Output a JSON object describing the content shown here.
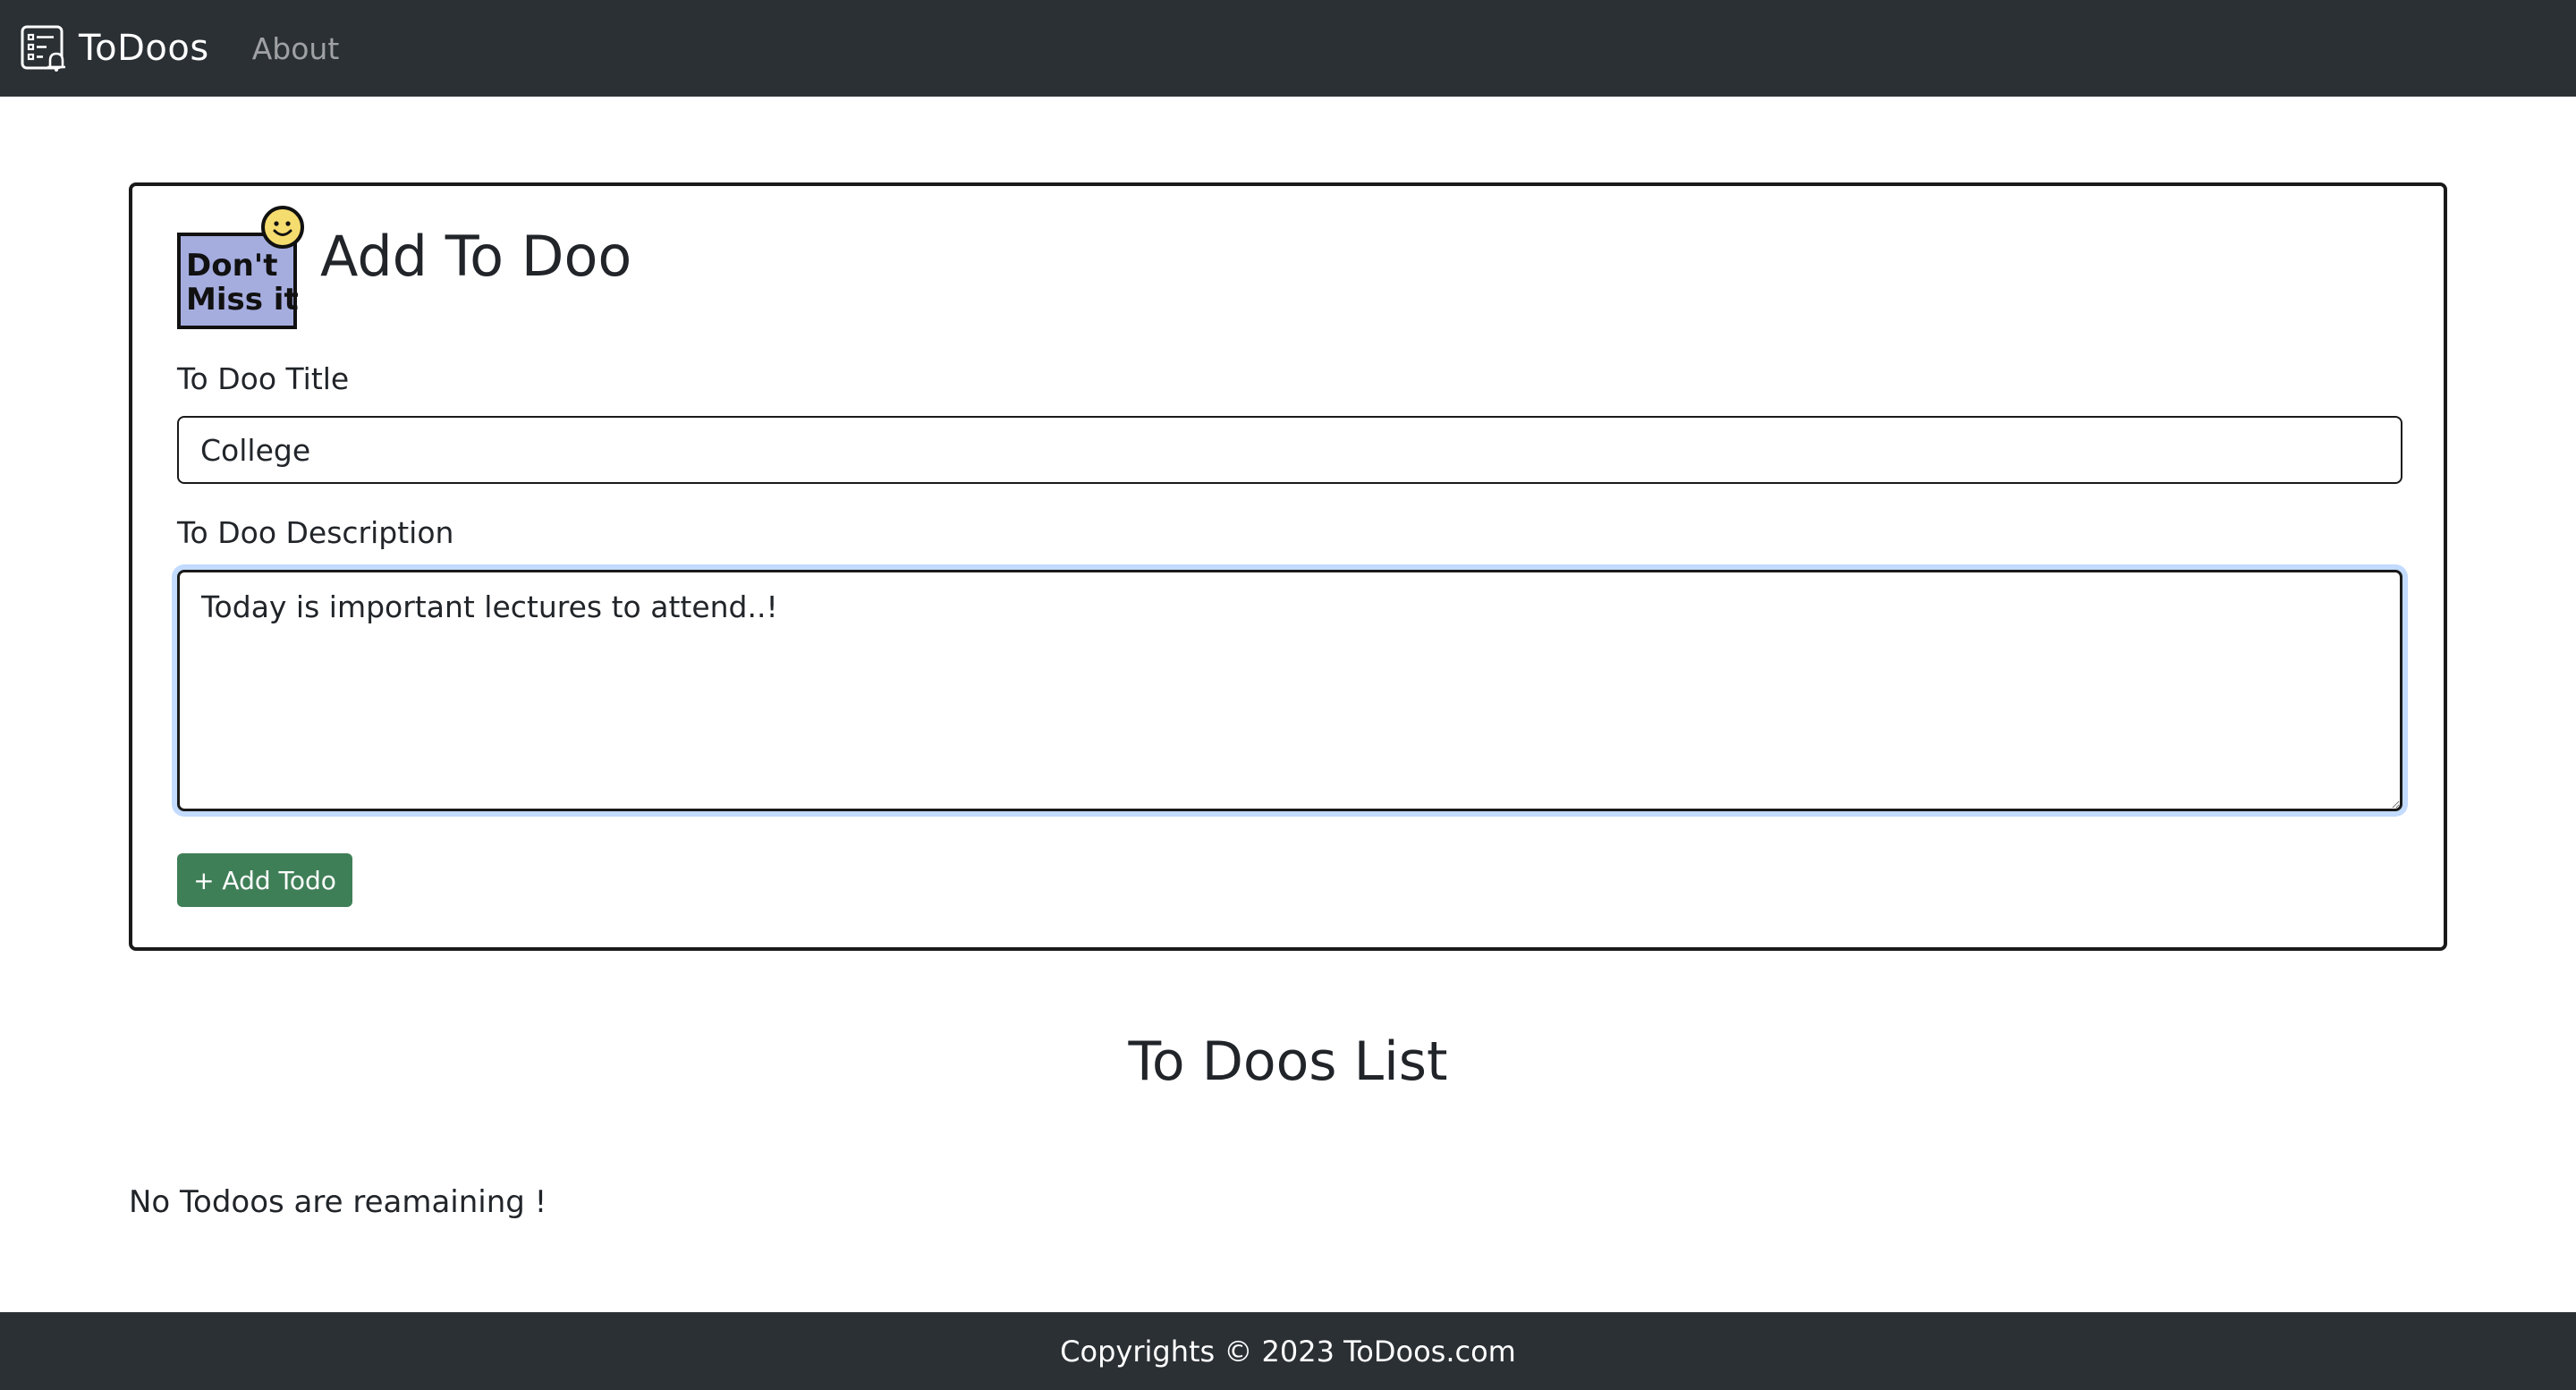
{
  "navbar": {
    "brand_icon": "todo-list-bell-icon",
    "brand_text": "ToDoos",
    "about_link": "About"
  },
  "add_card": {
    "logo_text_line1": "Don't",
    "logo_text_line2": "Miss it",
    "logo_icon": "dont-miss-it-smiley-logo",
    "title": "Add To Doo",
    "title_label": "To Doo Title",
    "title_value": "College",
    "description_label": "To Doo Description",
    "description_value": "Today is important lectures to attend..!",
    "add_button_label": "+ Add Todo"
  },
  "list": {
    "heading": "To Doos List",
    "empty_message": "No Todoos are reamaining !"
  },
  "footer": {
    "text": "Copyrights © 2023 ToDoos.com"
  },
  "colors": {
    "navbar_bg": "#2b3035",
    "footer_bg": "#2b3035",
    "button_bg": "#3f7f57",
    "logo_bg": "#a5addf",
    "smiley": "#f5dc6e"
  }
}
